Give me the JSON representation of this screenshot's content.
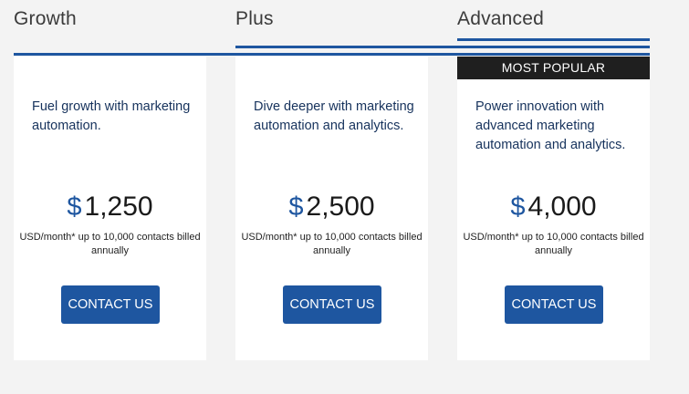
{
  "plans": [
    {
      "name": "Growth",
      "badge": "",
      "description": "Fuel growth with marketing automation.",
      "currency": "$",
      "price": "1,250",
      "terms": "USD/month* up to 10,000 contacts billed annually",
      "cta": "CONTACT US"
    },
    {
      "name": "Plus",
      "badge": "",
      "description": "Dive deeper with marketing automation and analytics.",
      "currency": "$",
      "price": "2,500",
      "terms": "USD/month* up to 10,000 contacts billed annually",
      "cta": "CONTACT US"
    },
    {
      "name": "Advanced",
      "badge": "MOST POPULAR",
      "description": "Power innovation with advanced marketing automation and analytics.",
      "currency": "$",
      "price": "4,000",
      "terms": "USD/month* up to 10,000 contacts billed annually",
      "cta": "CONTACT US"
    }
  ],
  "colors": {
    "accent": "#1e56a0",
    "badge_bg": "#1f1f1f",
    "page_bg": "#f3f3f3",
    "card_bg": "#ffffff",
    "description_text": "#16325c"
  }
}
